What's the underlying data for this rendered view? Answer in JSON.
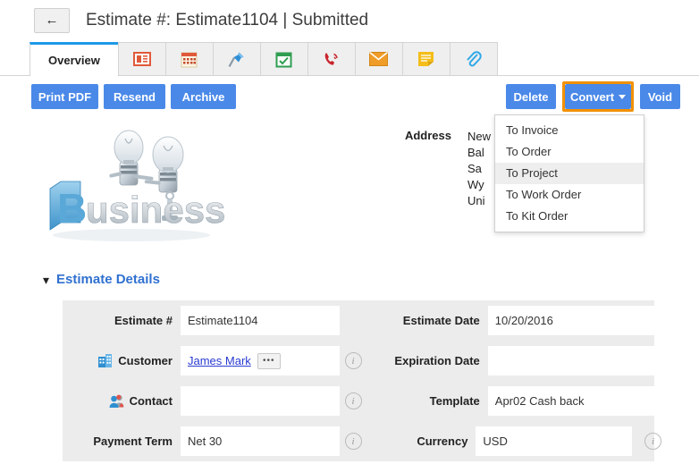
{
  "header": {
    "back_icon": "back-arrow-icon",
    "title": "Estimate #: Estimate1104 | Submitted"
  },
  "tabs": [
    {
      "label": "Overview",
      "icon": "overview-tab",
      "active": true
    },
    {
      "label": "",
      "icon": "invoice-list-icon",
      "active": false
    },
    {
      "label": "",
      "icon": "calendar-icon",
      "active": false
    },
    {
      "label": "",
      "icon": "pushpin-icon",
      "active": false
    },
    {
      "label": "",
      "icon": "task-checklist-icon",
      "active": false
    },
    {
      "label": "",
      "icon": "phone-call-icon",
      "active": false
    },
    {
      "label": "",
      "icon": "email-envelope-icon",
      "active": false
    },
    {
      "label": "",
      "icon": "note-icon",
      "active": false
    },
    {
      "label": "",
      "icon": "paperclip-attachment-icon",
      "active": false
    }
  ],
  "toolbar": {
    "print_pdf": "Print PDF",
    "resend": "Resend",
    "archive": "Archive",
    "delete": "Delete",
    "convert": "Convert",
    "void": "Void"
  },
  "convert_menu": {
    "items": [
      {
        "label": "To Invoice",
        "selected": false
      },
      {
        "label": "To Order",
        "selected": false
      },
      {
        "label": "To Project",
        "selected": true
      },
      {
        "label": "To Work Order",
        "selected": false
      },
      {
        "label": "To Kit Order",
        "selected": false
      }
    ]
  },
  "logo": {
    "alt": "Business 3D logo with light bulb robots",
    "word": "Business"
  },
  "address": {
    "label": "Address",
    "lines": [
      "New",
      "Bal",
      "Sa",
      "Wy",
      "Uni"
    ],
    "full_text": "New\nBal\nSa\nWy\nUni"
  },
  "section": {
    "chevron": "chevron-down-icon",
    "title": "Estimate Details"
  },
  "form": {
    "rows": [
      {
        "left": {
          "label": "Estimate #",
          "value": "Estimate1104",
          "icon": null,
          "info": false,
          "link": false
        },
        "right": {
          "label": "Estimate Date",
          "value": "10/20/2016",
          "info": false
        }
      },
      {
        "left": {
          "label": "Customer",
          "value": "James Mark",
          "icon": "building-icon",
          "info": true,
          "link": true,
          "ellipsis": "•••"
        },
        "right": {
          "label": "Expiration Date",
          "value": "",
          "info": true
        }
      },
      {
        "left": {
          "label": "Contact",
          "value": "",
          "icon": "people-icon",
          "info": true,
          "link": false
        },
        "right": {
          "label": "Template",
          "value": "Apr02 Cash back",
          "info": true
        }
      },
      {
        "left": {
          "label": "Payment Term",
          "value": "Net 30",
          "icon": null,
          "info": true,
          "link": false
        },
        "right": {
          "label": "Currency",
          "value": "USD",
          "info": true,
          "trailing_info": true
        }
      }
    ]
  },
  "colors": {
    "accent_blue": "#4a89e8",
    "tab_active_bar": "#1e9ae5",
    "highlight_orange": "#f29100",
    "panel_gray": "#ececec",
    "link_blue": "#2a3bd0",
    "section_blue": "#3071d0"
  }
}
